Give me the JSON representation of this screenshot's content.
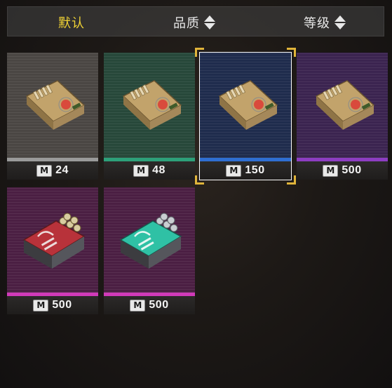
{
  "sort_bar": {
    "default_label": "默认",
    "quality_label": "品质",
    "level_label": "等级",
    "active_color": "#f2d435"
  },
  "currency_icon": "M",
  "items": [
    {
      "name": "ammo-box",
      "rarity": "gray",
      "price": "24",
      "selected": false
    },
    {
      "name": "ammo-box",
      "rarity": "green",
      "price": "48",
      "selected": false
    },
    {
      "name": "ammo-box",
      "rarity": "blue",
      "price": "150",
      "selected": true
    },
    {
      "name": "ammo-box",
      "rarity": "purple",
      "price": "500",
      "selected": false
    },
    {
      "name": "ammo-case-red",
      "rarity": "pink",
      "price": "500",
      "selected": false
    },
    {
      "name": "ammo-case-teal",
      "rarity": "pink",
      "price": "500",
      "selected": false
    }
  ],
  "rarity_colors": {
    "gray": "#9a9a9a",
    "green": "#2da07a",
    "blue": "#2f6fd3",
    "purple": "#8d3dc2",
    "pink": "#d13ab9"
  }
}
